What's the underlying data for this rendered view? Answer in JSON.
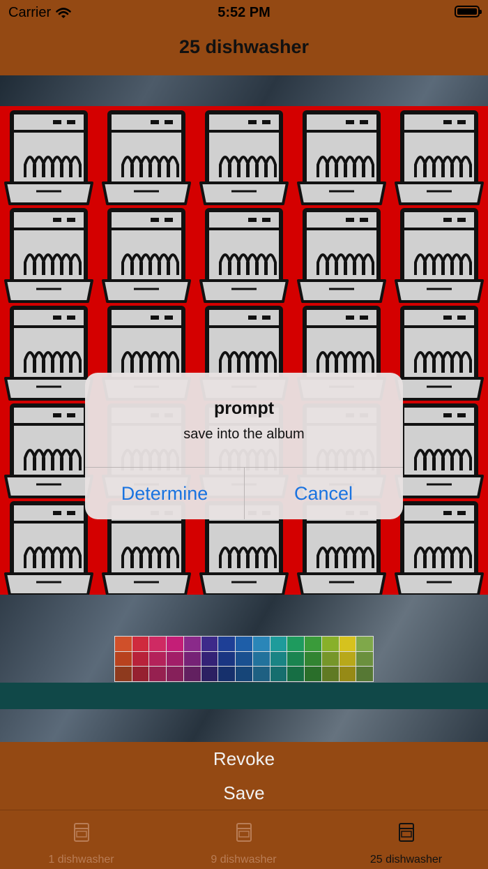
{
  "status_bar": {
    "carrier": "Carrier",
    "time": "5:52 PM"
  },
  "nav": {
    "title": "25 dishwasher"
  },
  "grid": {
    "rows": 5,
    "cols": 5,
    "icon": "dishwasher-icon",
    "background": "#d40000"
  },
  "palette": {
    "colors": [
      [
        "#d0502a",
        "#cf2a3e",
        "#cf2a63",
        "#c41e77",
        "#8a2a8a",
        "#3d2a8a",
        "#1e3f96",
        "#1e5ea8",
        "#2a86b8",
        "#1e9b9b",
        "#1e9b5e",
        "#3a9b3a",
        "#88b02a",
        "#d6c21e"
      ],
      [
        "#b8421e",
        "#b8223a",
        "#b4225a",
        "#a21e68",
        "#762276",
        "#342276",
        "#1a3682",
        "#1a5090",
        "#22729c",
        "#1a8484",
        "#1a8450",
        "#328432",
        "#76962a",
        "#b8a81a"
      ],
      [
        "#8e3a1e",
        "#962030",
        "#962050",
        "#86205a",
        "#622060",
        "#2c2062",
        "#16306c",
        "#164578",
        "#1e6082",
        "#166e6e",
        "#166e44",
        "#2a6e2a",
        "#607a24",
        "#968a16"
      ]
    ],
    "extra_column": [
      "#7fa84a",
      "#6b903e",
      "#567834"
    ]
  },
  "actions": {
    "revoke": "Revoke",
    "save": "Save"
  },
  "tabs": [
    {
      "label": "1 dishwasher",
      "icon": "dishwasher-icon",
      "active": false
    },
    {
      "label": "9 dishwasher",
      "icon": "dishwasher-icon",
      "active": false
    },
    {
      "label": "25 dishwasher",
      "icon": "dishwasher-icon",
      "active": true
    }
  ],
  "dialog": {
    "title": "prompt",
    "message": "save into the album",
    "confirm": "Determine",
    "cancel": "Cancel"
  },
  "colors": {
    "nav_bg": "#944913",
    "accent_blue": "#1a73e0",
    "teal_bar": "#104848"
  }
}
